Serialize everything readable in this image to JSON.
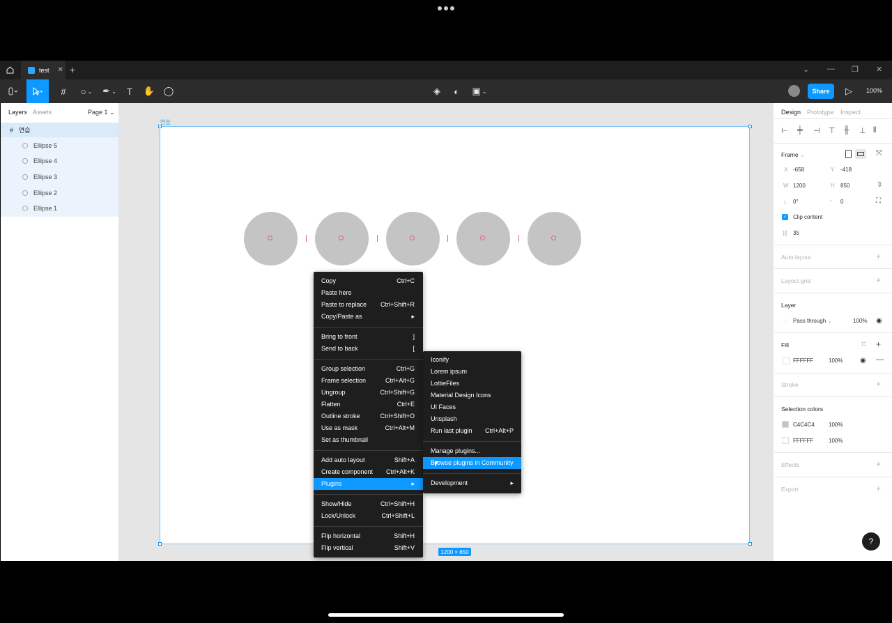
{
  "tab": {
    "title": "test"
  },
  "toolbar": {
    "share_label": "Share",
    "zoom": "100%"
  },
  "layers_panel": {
    "tab_layers": "Layers",
    "tab_assets": "Assets",
    "page_selector": "Page 1",
    "frame_name": "연습",
    "items": [
      "Ellipse 5",
      "Ellipse 4",
      "Ellipse 3",
      "Ellipse 2",
      "Ellipse 1"
    ]
  },
  "canvas": {
    "frame_label": "연습",
    "size_badge": "1200 × 850"
  },
  "context_menu": {
    "groups": [
      [
        {
          "label": "Copy",
          "shortcut": "Ctrl+C"
        },
        {
          "label": "Paste here",
          "shortcut": ""
        },
        {
          "label": "Paste to replace",
          "shortcut": "Ctrl+Shift+R"
        },
        {
          "label": "Copy/Paste as",
          "shortcut": "▸"
        }
      ],
      [
        {
          "label": "Bring to front",
          "shortcut": "]"
        },
        {
          "label": "Send to back",
          "shortcut": "["
        }
      ],
      [
        {
          "label": "Group selection",
          "shortcut": "Ctrl+G"
        },
        {
          "label": "Frame selection",
          "shortcut": "Ctrl+Alt+G"
        },
        {
          "label": "Ungroup",
          "shortcut": "Ctrl+Shift+G"
        },
        {
          "label": "Flatten",
          "shortcut": "Ctrl+E"
        },
        {
          "label": "Outline stroke",
          "shortcut": "Ctrl+Shift+O"
        },
        {
          "label": "Use as mask",
          "shortcut": "Ctrl+Alt+M"
        },
        {
          "label": "Set as thumbnail",
          "shortcut": ""
        }
      ],
      [
        {
          "label": "Add auto layout",
          "shortcut": "Shift+A"
        },
        {
          "label": "Create component",
          "shortcut": "Ctrl+Alt+K"
        },
        {
          "label": "Plugins",
          "shortcut": "▸",
          "highlighted": true
        }
      ],
      [
        {
          "label": "Show/Hide",
          "shortcut": "Ctrl+Shift+H"
        },
        {
          "label": "Lock/Unlock",
          "shortcut": "Ctrl+Shift+L"
        }
      ],
      [
        {
          "label": "Flip horizontal",
          "shortcut": "Shift+H"
        },
        {
          "label": "Flip vertical",
          "shortcut": "Shift+V"
        }
      ]
    ]
  },
  "plugins_submenu": {
    "groups": [
      [
        {
          "label": "Iconify",
          "shortcut": ""
        },
        {
          "label": "Lorem ipsum",
          "shortcut": ""
        },
        {
          "label": "LottieFiles",
          "shortcut": ""
        },
        {
          "label": "Material Design Icons",
          "shortcut": ""
        },
        {
          "label": "UI Faces",
          "shortcut": ""
        },
        {
          "label": "Unsplash",
          "shortcut": ""
        },
        {
          "label": "Run last plugin",
          "shortcut": "Ctrl+Alt+P"
        }
      ],
      [
        {
          "label": "Manage plugins...",
          "shortcut": ""
        },
        {
          "label": "Browse plugins in Community",
          "shortcut": "",
          "highlighted": true
        }
      ],
      [
        {
          "label": "Development",
          "shortcut": "▸"
        }
      ]
    ]
  },
  "design_panel": {
    "tabs": [
      "Design",
      "Prototype",
      "Inspect"
    ],
    "frame_label": "Frame",
    "x_label": "X",
    "x": "-658",
    "y_label": "Y",
    "y": "-418",
    "w_label": "W",
    "w": "1200",
    "h_label": "H",
    "h": "850",
    "rotation": "0°",
    "radius": "0",
    "clip_content": "Clip content",
    "spacing": "35",
    "auto_layout": "Auto layout",
    "layout_grid": "Layout grid",
    "layer_title": "Layer",
    "blend_mode": "Pass through",
    "layer_opacity": "100%",
    "fill_title": "Fill",
    "fill_hex": "FFFFFF",
    "fill_opacity": "100%",
    "stroke": "Stroke",
    "selection_colors_title": "Selection colors",
    "selection_colors": [
      {
        "hex": "C4C4C4",
        "opacity": "100%",
        "color": "#C4C4C4"
      },
      {
        "hex": "FFFFFF",
        "opacity": "100%",
        "color": "#FFFFFF"
      }
    ],
    "effects": "Effects",
    "export": "Export"
  },
  "colors": {
    "accent": "#0d99ff",
    "ellipse": "#c4c4c4",
    "spacing_mark": "#e35ba9"
  }
}
